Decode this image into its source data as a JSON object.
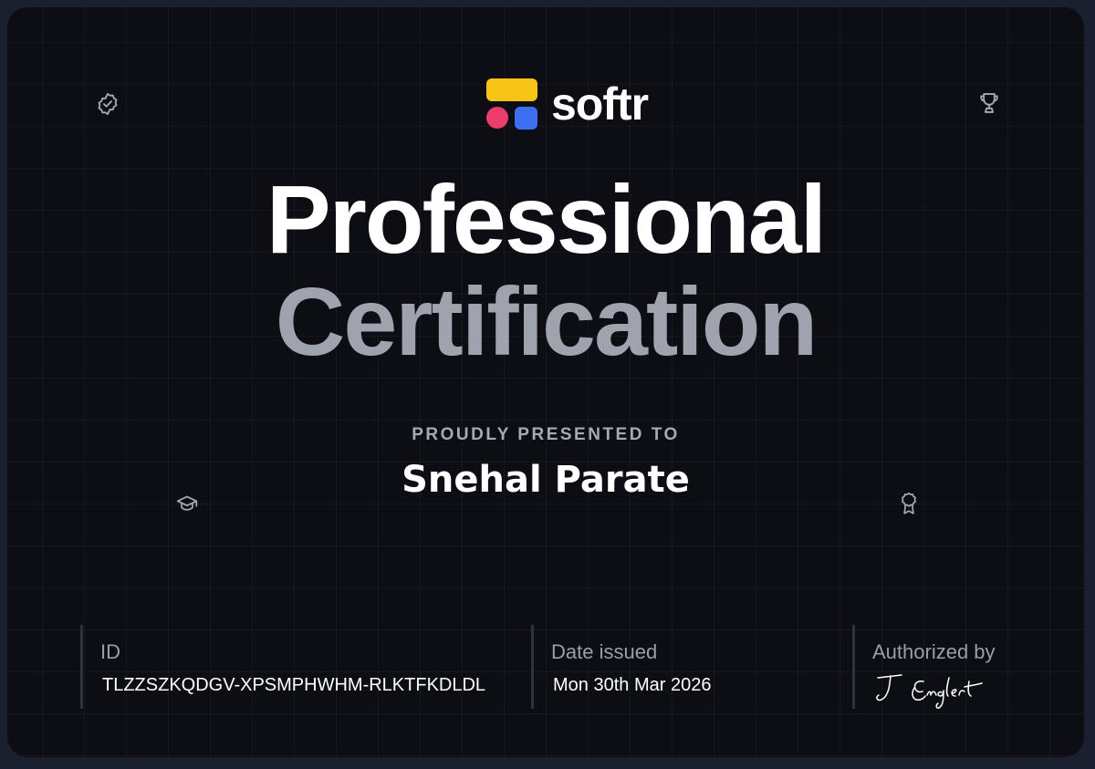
{
  "brand": {
    "name": "softr",
    "colors": {
      "yellow": "#f8c416",
      "pink": "#ec3c6b",
      "blue": "#3e6ff2"
    }
  },
  "certificate": {
    "title_line1": "Professional",
    "title_line2": "Certification",
    "presented_label": "PROUDLY PRESENTED TO",
    "recipient": "Snehal Parate"
  },
  "details": {
    "id_label": "ID",
    "id_value": "TLZZSZKQDGV-XPSMPHWHM-RLKTFKDLDL",
    "date_label": "Date issued",
    "date_value": "Mon 30th Mar 2026",
    "authorized_label": "Authorized by",
    "signature_text": "J Englert"
  },
  "icons": {
    "top_left": "verified-badge-icon",
    "top_right": "trophy-icon",
    "mid_left": "graduation-cap-icon",
    "mid_right": "award-ribbon-icon"
  }
}
